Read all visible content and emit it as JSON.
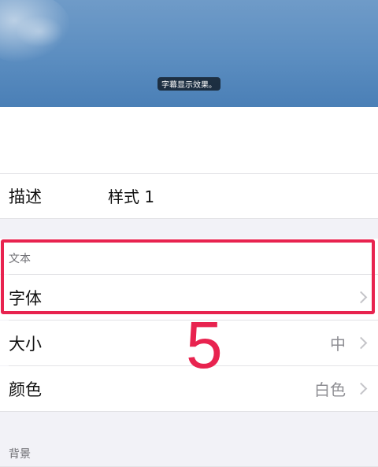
{
  "preview": {
    "sample_text": "字幕显示效果。"
  },
  "description_row": {
    "label": "描述",
    "value": "样式 1"
  },
  "text_section": {
    "header": "文本",
    "rows": [
      {
        "label": "字体",
        "value": ""
      },
      {
        "label": "大小",
        "value": "中"
      },
      {
        "label": "颜色",
        "value": "白色"
      }
    ]
  },
  "background_section": {
    "header": "背景"
  },
  "annotation": {
    "step_number": "5",
    "highlight_color": "#e8234f"
  }
}
